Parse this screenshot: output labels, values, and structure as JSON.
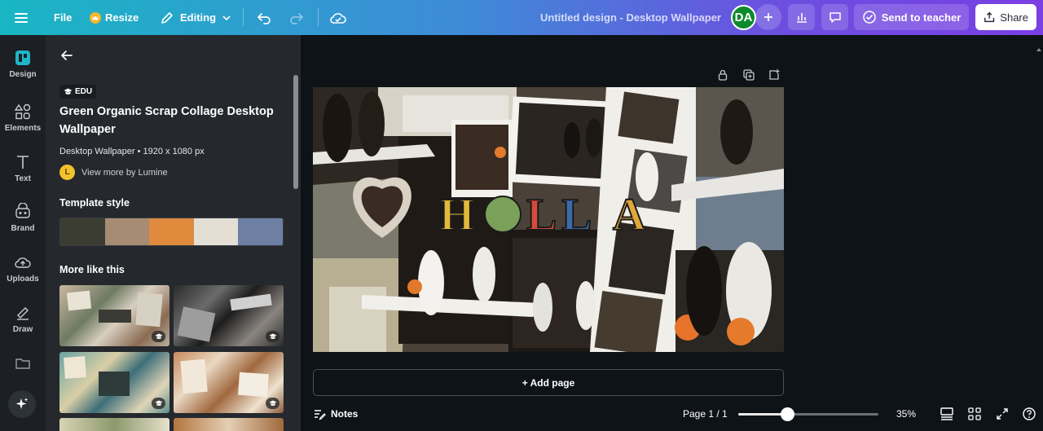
{
  "topbar": {
    "menu_icon": "hamburger-icon",
    "file_label": "File",
    "resize_label": "Resize",
    "editing_label": "Editing",
    "document_title": "Untitled design - Desktop Wallpaper",
    "avatar_initials": "DA",
    "send_to_teacher_label": "Send to teacher",
    "share_label": "Share"
  },
  "rail": {
    "items": [
      {
        "label": "Design",
        "icon": "design-icon"
      },
      {
        "label": "Elements",
        "icon": "elements-icon"
      },
      {
        "label": "Text",
        "icon": "text-icon"
      },
      {
        "label": "Brand",
        "icon": "brand-icon"
      },
      {
        "label": "Uploads",
        "icon": "uploads-icon"
      },
      {
        "label": "Draw",
        "icon": "draw-icon"
      },
      {
        "label": "",
        "icon": "folder-icon"
      },
      {
        "label": "",
        "icon": "magic-sparkle-icon"
      }
    ]
  },
  "panel": {
    "badge": "EDU",
    "title": "Green Organic Scrap Collage Desktop Wallpaper",
    "meta": "Desktop Wallpaper • 1920 x 1080 px",
    "creator_initial": "L",
    "creator_link": "View more by Lumine",
    "template_style_heading": "Template style",
    "palette": [
      "#3b3d33",
      "#a58c73",
      "#e08a3e",
      "#e3dfd5",
      "#6d7fa3"
    ],
    "more_heading": "More like this"
  },
  "design": {
    "headline": "HOLLA"
  },
  "canvas": {
    "add_page_label": "+ Add page"
  },
  "bottombar": {
    "notes_label": "Notes",
    "page_indicator": "Page 1 / 1",
    "zoom_label": "35%",
    "zoom_fraction": 0.35
  },
  "colors": {
    "accent": "#7b3fe4",
    "panel_bg": "#25282d",
    "canvas_bg": "#0e1318"
  }
}
